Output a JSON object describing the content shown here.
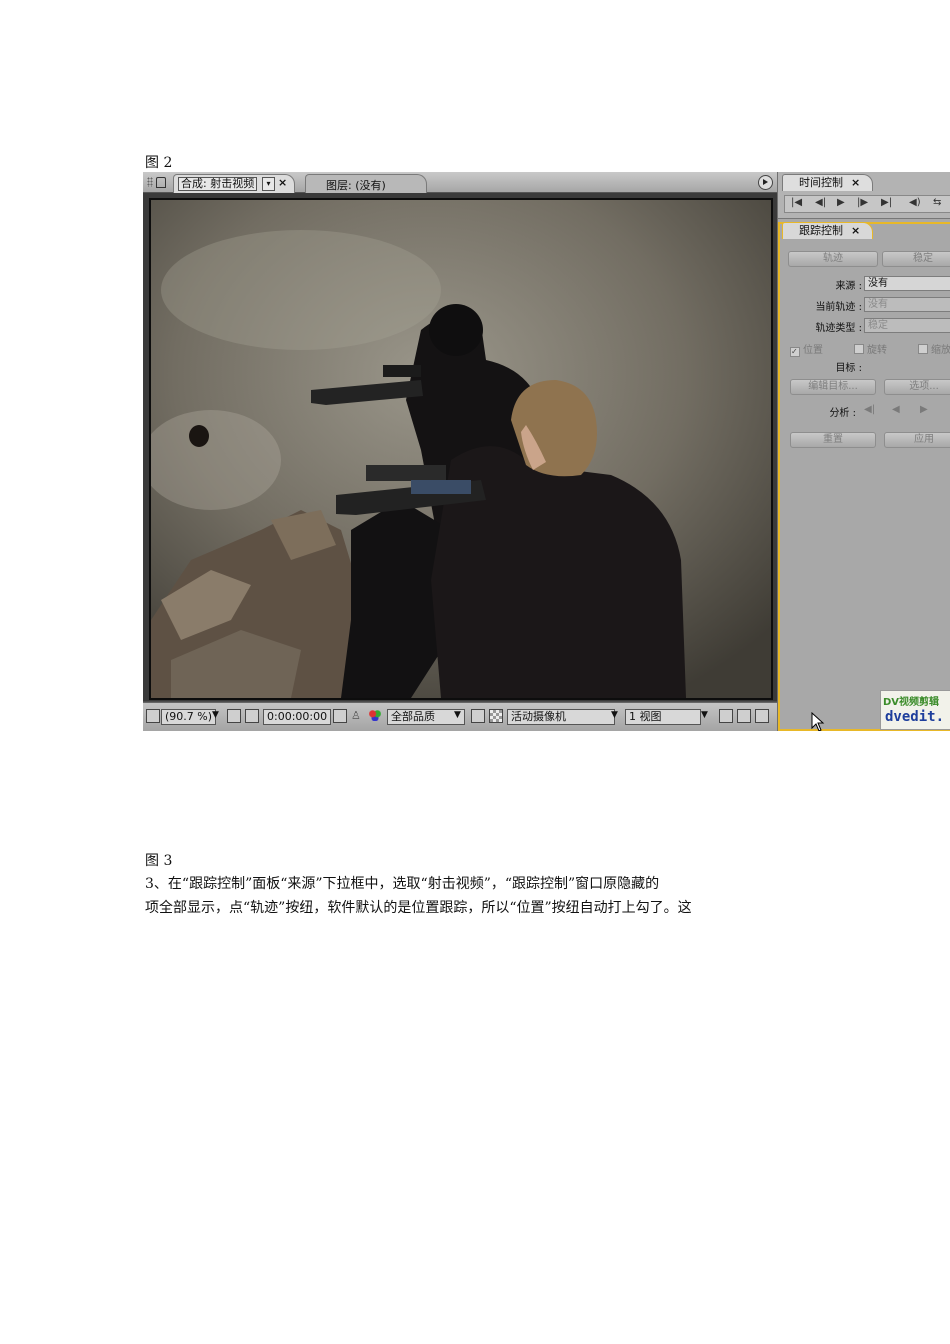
{
  "figure2_caption": "图 2",
  "screenshot": {
    "comp_tab": {
      "label": "合成: 射击视频",
      "dropdown": "▾",
      "close": "×"
    },
    "layer_tab": {
      "label": "图层: (没有)"
    },
    "status": {
      "zoom": "(90.7 %)",
      "timecode": "0:00:00:00",
      "quality": "全部品质",
      "camera": "活动摄像机",
      "views": "1 视图"
    },
    "time_panel": {
      "title": "时间控制",
      "close": "×"
    },
    "track_panel": {
      "title": "跟踪控制",
      "close": "×",
      "track_button": "轨迹",
      "stabilize_button": "稳定",
      "source_label": "来源 :",
      "source_value": "没有",
      "current_track_label": "当前轨迹 :",
      "current_track_value": "没有",
      "track_type_label": "轨迹类型 :",
      "track_type_value": "稳定",
      "position_check": "位置",
      "rotation_check": "旋转",
      "scale_check": "缩放",
      "target_label": "目标 :",
      "edit_target_button": "编辑目标...",
      "options_button": "选项...",
      "analyze_label": "分析 :",
      "reset_button": "重置",
      "apply_button": "应用"
    },
    "watermark": {
      "line1": "DV视频剪辑",
      "line2": "dvedit."
    }
  },
  "figure3_caption": "图 3",
  "paragraph_line1": "3、在“跟踪控制”面板“来源”下拉框中，选取“射击视频”，“跟踪控制”窗口原隐藏的",
  "paragraph_line2": "项全部显示，点“轨迹”按纽，软件默认的是位置跟踪，所以“位置”按纽自动打上勾了。这"
}
